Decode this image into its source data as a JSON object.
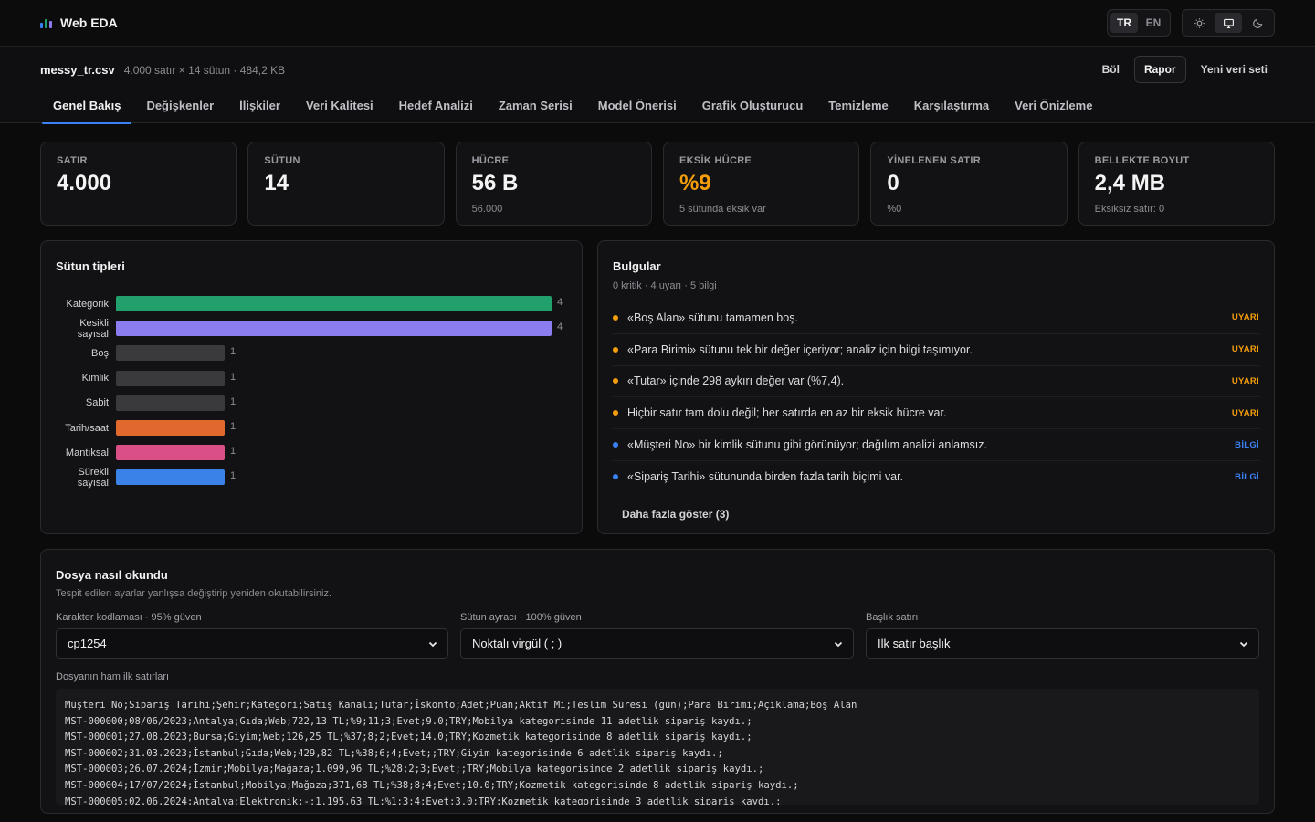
{
  "app": {
    "title": "Web EDA"
  },
  "lang": {
    "options": [
      "TR",
      "EN"
    ],
    "active": "TR"
  },
  "theme": {
    "options": [
      "sun-icon",
      "monitor-icon",
      "moon-icon"
    ],
    "active": "monitor-icon"
  },
  "file": {
    "name": "messy_tr.csv",
    "meta": "4.000 satır × 14 sütun · 484,2 KB",
    "actions": {
      "split": "Böl",
      "report": "Rapor",
      "new_dataset": "Yeni veri seti"
    }
  },
  "tabs": [
    {
      "label": "Genel Bakış",
      "active": true
    },
    {
      "label": "Değişkenler"
    },
    {
      "label": "İlişkiler"
    },
    {
      "label": "Veri Kalitesi"
    },
    {
      "label": "Hedef Analizi"
    },
    {
      "label": "Zaman Serisi"
    },
    {
      "label": "Model Önerisi"
    },
    {
      "label": "Grafik Oluşturucu"
    },
    {
      "label": "Temizleme"
    },
    {
      "label": "Karşılaştırma"
    },
    {
      "label": "Veri Önizleme"
    }
  ],
  "stats": [
    {
      "label": "SATIR",
      "value": "4.000",
      "sub": ""
    },
    {
      "label": "SÜTUN",
      "value": "14",
      "sub": ""
    },
    {
      "label": "HÜCRE",
      "value": "56 B",
      "sub": "56.000"
    },
    {
      "label": "EKSİK HÜCRE",
      "value": "%9",
      "sub": "5 sütunda eksik var",
      "warn": true
    },
    {
      "label": "YİNELENEN SATIR",
      "value": "0",
      "sub": "%0"
    },
    {
      "label": "BELLEKTE BOYUT",
      "value": "2,4 MB",
      "sub": "Eksiksiz satır: 0"
    }
  ],
  "column_types": {
    "title": "Sütun tipleri",
    "max": 4,
    "items": [
      {
        "label": "Kategorik",
        "value": 4,
        "color": "#22a06b"
      },
      {
        "label": "Kesikli sayısal",
        "value": 4,
        "color": "#8b7cf0"
      },
      {
        "label": "Boş",
        "value": 1,
        "color": "#3a3a3d"
      },
      {
        "label": "Kimlik",
        "value": 1,
        "color": "#3a3a3d"
      },
      {
        "label": "Sabit",
        "value": 1,
        "color": "#3a3a3d"
      },
      {
        "label": "Tarih/saat",
        "value": 1,
        "color": "#e2692e"
      },
      {
        "label": "Mantıksal",
        "value": 1,
        "color": "#d94f86"
      },
      {
        "label": "Sürekli sayısal",
        "value": 1,
        "color": "#3b82e8"
      }
    ]
  },
  "findings": {
    "title": "Bulgular",
    "summary": "0 kritik · 4 uyarı · 5 bilgi",
    "items": [
      {
        "text": "«Boş Alan» sütunu tamamen boş.",
        "badge": "UYARI",
        "color": "#f59e0b"
      },
      {
        "text": "«Para Birimi» sütunu tek bir değer içeriyor; analiz için bilgi taşımıyor.",
        "badge": "UYARI",
        "color": "#f59e0b"
      },
      {
        "text": "«Tutar» içinde 298 aykırı değer var (%7,4).",
        "badge": "UYARI",
        "color": "#f59e0b"
      },
      {
        "text": "Hiçbir satır tam dolu değil; her satırda en az bir eksik hücre var.",
        "badge": "UYARI",
        "color": "#f59e0b"
      },
      {
        "text": "«Müşteri No» bir kimlik sütunu gibi görünüyor; dağılım analizi anlamsız.",
        "badge": "BİLGİ",
        "color": "#3b82f6"
      },
      {
        "text": "«Sipariş Tarihi» sütununda birden fazla tarih biçimi var.",
        "badge": "BİLGİ",
        "color": "#3b82f6"
      }
    ],
    "more_label": "Daha fazla göster (3)"
  },
  "read": {
    "title": "Dosya nasıl okundu",
    "subtitle": "Tespit edilen ayarlar yanlışsa değiştirip yeniden okutabilirsiniz.",
    "encoding": {
      "label": "Karakter kodlaması",
      "confidence": "· 95% güven",
      "value": "cp1254"
    },
    "separator": {
      "label": "Sütun ayracı",
      "confidence": "· 100% güven",
      "value": "Noktalı virgül ( ; )"
    },
    "header": {
      "label": "Başlık satırı",
      "confidence": "",
      "value": "İlk satır başlık"
    },
    "raw_label": "Dosyanın ham ilk satırları",
    "raw_lines": [
      "Müşteri No;Sipariş Tarihi;Şehir;Kategori;Satış Kanalı;Tutar;İskonto;Adet;Puan;Aktif Mi;Teslim Süresi (gün);Para Birimi;Açıklama;Boş Alan",
      "MST-000000;08/06/2023;Antalya;Gıda;Web;722,13 TL;%9;11;3;Evet;9.0;TRY;Mobilya kategorisinde 11 adetlik sipariş kaydı.;",
      "MST-000001;27.08.2023;Bursa;Giyim;Web;126,25 TL;%37;8;2;Evet;14.0;TRY;Kozmetik kategorisinde 8 adetlik sipariş kaydı.;",
      "MST-000002;31.03.2023;İstanbul;Gıda;Web;429,82 TL;%38;6;4;Evet;;TRY;Giyim kategorisinde 6 adetlik sipariş kaydı.;",
      "MST-000003;26.07.2024;İzmir;Mobilya;Mağaza;1.099,96 TL;%28;2;3;Evet;;TRY;Mobilya kategorisinde 2 adetlik sipariş kaydı.;",
      "MST-000004;17/07/2024;İstanbul;Mobilya;Mağaza;371,68 TL;%38;8;4;Evet;10.0;TRY;Kozmetik kategorisinde 8 adetlik sipariş kaydı.;",
      "MST-000005;02.06.2024;Antalya;Elektronik;-;1.195,63 TL;%1;3;4;Evet;3.0;TRY;Kozmetik kategorisinde 3 adetlik sipariş kaydı.;"
    ]
  }
}
